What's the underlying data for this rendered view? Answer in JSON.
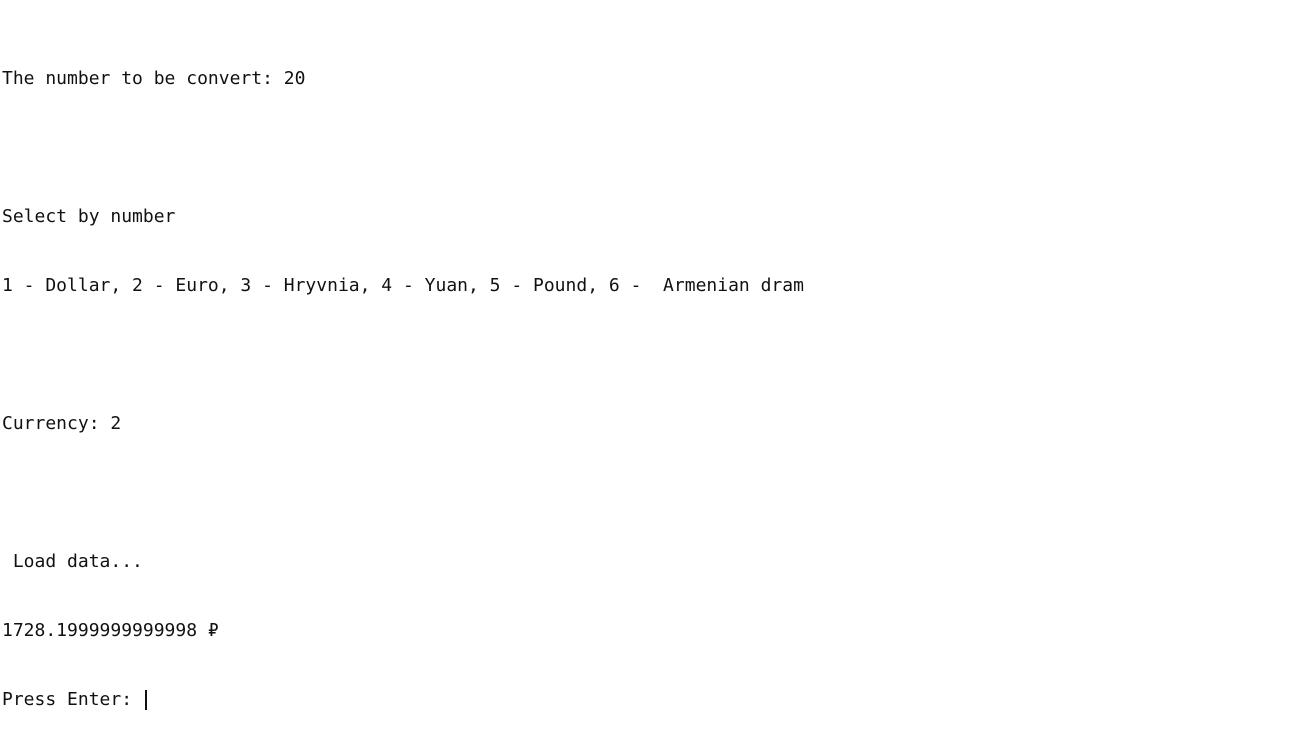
{
  "terminal": {
    "lines": {
      "prompt_number": "The number to be convert: 20",
      "select_header": "Select by number",
      "currency_options": "1 - Dollar, 2 - Euro, 3 - Hryvnia, 4 - Yuan, 5 - Pound, 6 -  Armenian dram",
      "currency_choice": "Currency: 2",
      "loading": " Load data...",
      "result": "1728.1999999999998 ₽",
      "press_enter": "Press Enter: "
    }
  }
}
